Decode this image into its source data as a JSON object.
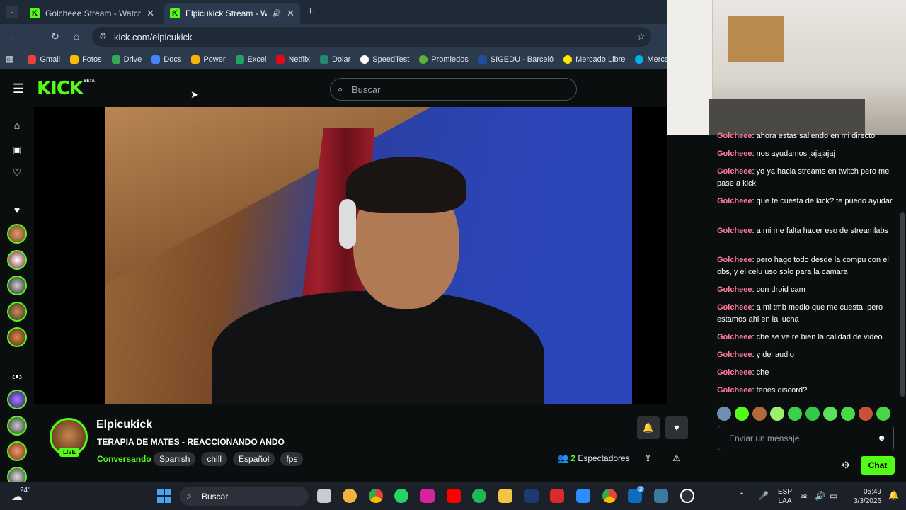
{
  "browser": {
    "tabs": [
      {
        "title": "Golcheee Stream - Watch Live o",
        "active": false
      },
      {
        "title": "Elpicukick Stream - Watch Li",
        "active": true
      }
    ],
    "url": "kick.com/elpicukick",
    "bookmarks": [
      {
        "label": "Gmail",
        "color": "#ea4335"
      },
      {
        "label": "Fotos",
        "color": "#fbbc04"
      },
      {
        "label": "Drive",
        "color": "#34a853"
      },
      {
        "label": "Docs",
        "color": "#4285f4"
      },
      {
        "label": "Power",
        "color": "#f4b400"
      },
      {
        "label": "Excel",
        "color": "#21a366"
      },
      {
        "label": "Netflix",
        "color": "#e50914"
      },
      {
        "label": "Dolar",
        "color": "#1f8a70"
      },
      {
        "label": "SpeedTest",
        "color": "#ffffff"
      },
      {
        "label": "Promiedos",
        "color": "#5fb233"
      },
      {
        "label": "SIGEDU - Barceló",
        "color": "#1e4e9c"
      },
      {
        "label": "Mercado Libre",
        "color": "#ffe600"
      },
      {
        "label": "Mercado Pago",
        "color": "#00b1ea"
      }
    ]
  },
  "kick": {
    "logo": "KICK",
    "beta": "BETA",
    "search_placeholder": "Buscar",
    "accent": "#53fc18"
  },
  "channel": {
    "name": "Elpicukick",
    "live_badge": "LIVE",
    "stream_title": "TERAPIA DE MATES - REACCIONANDO ANDO",
    "category": "Conversando",
    "tags": [
      "Spanish",
      "chill",
      "Español",
      "fps"
    ],
    "viewers_count": "2",
    "viewers_label": "Espectadores"
  },
  "chat": {
    "messages": [
      {
        "user": "Golcheee",
        "text": ": ahora estas saliendo en mi directo"
      },
      {
        "user": "Golcheee",
        "text": ": nos ayudamos jajajajaj"
      },
      {
        "user": "Golcheee",
        "text": ": yo ya hacia streams en twitch pero me pase a kick"
      },
      {
        "user": "Golcheee",
        "text": ": que te cuesta de kick? te puedo ayudar"
      },
      {
        "user": "Golcheee",
        "text": ": a mi me falta hacer eso de streamlabs"
      },
      {
        "user": "Golcheee",
        "text": ": pero hago todo desde la compu con el obs, y el celu uso solo para la camara"
      },
      {
        "user": "Golcheee",
        "text": ": con droid cam"
      },
      {
        "user": "Golcheee",
        "text": ": a mi tmb medio que me cuesta, pero estamos ahi en la lucha"
      },
      {
        "user": "Golcheee",
        "text": ": che se ve re bien la calidad de video"
      },
      {
        "user": "Golcheee",
        "text": ": y del audio"
      },
      {
        "user": "Golcheee",
        "text": ": che"
      },
      {
        "user": "Golcheee",
        "text": ": tenes discord?"
      }
    ],
    "input_placeholder": "Enviar un mensaje",
    "send_label": "Chat"
  },
  "taskbar": {
    "temperature": "24°",
    "search_placeholder": "Buscar",
    "lang_line1": "ESP",
    "lang_line2": "LAA",
    "time": "05:49",
    "date": "3/3/2026",
    "outlook_badge": "2"
  }
}
